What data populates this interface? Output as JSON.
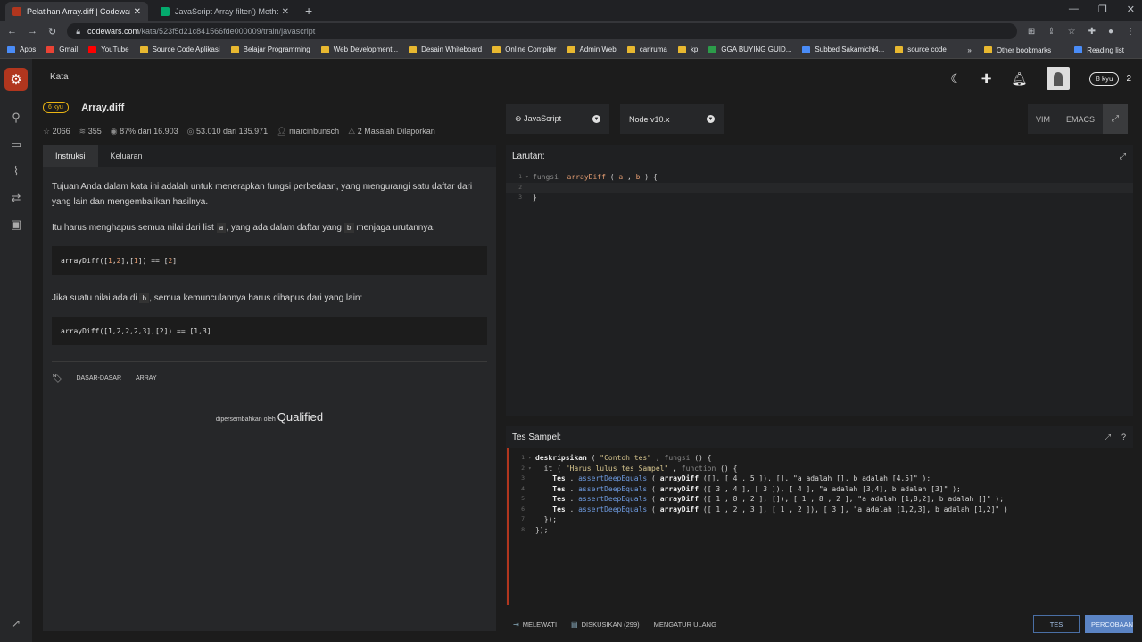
{
  "browser": {
    "tabs": [
      {
        "title": "Pelatihan Array.diff | Codewars",
        "active": true,
        "favicon_color": "#b1361e"
      },
      {
        "title": "JavaScript Array filter() Method",
        "active": false,
        "favicon_color": "#04aa6d"
      }
    ],
    "new_tab": "+",
    "window_controls": [
      "—",
      "❐",
      "✕"
    ],
    "url_host": "codewars.com",
    "url_path": "/kata/523f5d21c841566fde000009/train/javascript",
    "bookmarks": [
      "Apps",
      "Gmail",
      "YouTube",
      "Source Code Aplikasi",
      "Belajar Programming",
      "Web Development...",
      "Desain Whiteboard",
      "Online Compiler",
      "Admin Web",
      "cariruma",
      "kp",
      "GGA BUYING GUID...",
      "Subbed Sakamichi4...",
      "source code"
    ],
    "bookmarks_more": "»",
    "other_bookmarks": "Other bookmarks",
    "reading_list": "Reading list"
  },
  "topbar": {
    "breadcrumb": "Kata",
    "rank": "8 kyu",
    "honor": "2"
  },
  "kata": {
    "kyu": "6 kyu",
    "title": "Array.diff",
    "stats": {
      "favorites": "2066",
      "collections": "355",
      "satisfaction": "87% dari 16.903",
      "completed": "53.010 dari 135.971",
      "author": "marcinbunsch",
      "issues": "2 Masalah Dilaporkan"
    }
  },
  "description": {
    "tabs": [
      "Instruksi",
      "Keluaran"
    ],
    "p1": "Tujuan Anda dalam kata ini adalah untuk menerapkan fungsi perbedaan, yang mengurangi satu daftar dari yang lain dan mengembalikan hasilnya.",
    "p2_a": "Itu harus menghapus semua nilai dari list",
    "p2_code_a": "a",
    "p2_b": ", yang ada dalam daftar yang",
    "p2_code_b": "b",
    "p2_c": "menjaga urutannya.",
    "example1_head": "arrayDiff([",
    "example1_n1": "1",
    "example1_sep1": ",",
    "example1_n2": "2",
    "example1_mid": "],[",
    "example1_n3": "1",
    "example1_tail": "]) == [",
    "example1_n4": "2",
    "example1_end": "]",
    "p3_a": "Jika suatu nilai ada di",
    "p3_code": "b",
    "p3_b": ", semua kemunculannya harus dihapus dari yang lain:",
    "example2": "arrayDiff([1,2,2,2,3],[2]) == [1,3]",
    "tags": [
      "DASAR-DASAR",
      "ARRAY"
    ],
    "sponsor_prefix": "dipersembahkan oleh",
    "sponsor": "Qualified"
  },
  "editor": {
    "language": "JavaScript",
    "runtime": "Node v10.x",
    "modes": [
      "VIM",
      "EMACS"
    ],
    "solution_title": "Larutan:",
    "solution_lines": {
      "l1_kw": "fungsi",
      "l1_fn": "arrayDiff",
      "l1_rest_a": " ( ",
      "l1_p1": "a",
      "l1_rest_b": " , ",
      "l1_p2": "b",
      "l1_rest_c": " ) {",
      "l3": "}"
    },
    "tests_title": "Tes Sampel:",
    "tests": {
      "l1_a": "deskripsikan",
      "l1_b": " ( ",
      "l1_str": "\"Contoh tes\"",
      "l1_c": " , ",
      "l1_kw": "fungsi",
      "l1_d": " () {",
      "l2_a": "  it ( ",
      "l2_str": "\"Harus lulus tes Sampel\"",
      "l2_b": " , ",
      "l2_kw": "function",
      "l2_c": " () {",
      "l3": "([], [ 4 , 5 ]), [], \"a adalah [], b adalah [4,5]\" );",
      "l4": "([ 3 , 4 ], [ 3 ]), [ 4 ], \"a adalah [3,4], b adalah [3]\" );",
      "l5": "([ 1 , 8 , 2 ], []), [ 1 , 8 , 2 ], \"a adalah [1,8,2], b adalah []\" );",
      "l6": "([ 1 , 2 , 3 ], [ 1 , 2 ]), [ 3 ], \"a adalah [1,2,3], b adalah [1,2]\" )",
      "tes": "Tes",
      "dot": " . ",
      "assert": "assertDeepEquals",
      "fn": "arrayDiff",
      "l7": "  });",
      "l8": "});"
    }
  },
  "bottom": {
    "skip": "MELEWATI",
    "discuss": "DISKUSIKAN (299)",
    "reset": "MENGATUR ULANG",
    "test": "TES",
    "attempt": "PERCOBAAN"
  }
}
